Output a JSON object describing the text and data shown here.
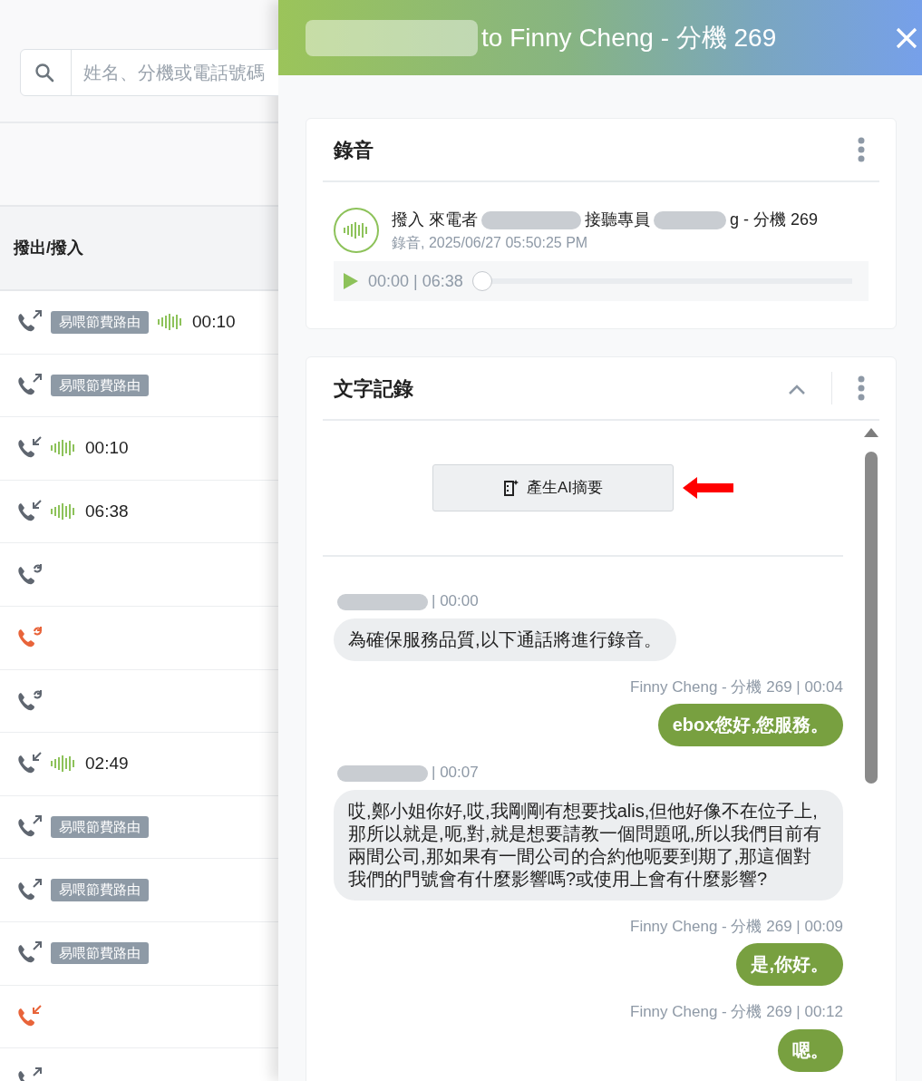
{
  "search": {
    "placeholder": "姓名、分機或電話號碼"
  },
  "table": {
    "columns": [
      "撥出/撥入"
    ],
    "rows": [
      {
        "kind": "outgoing",
        "missed": false,
        "tag": "易喂節費路由",
        "recording": "00:10"
      },
      {
        "kind": "outgoing",
        "missed": false,
        "tag": "易喂節費路由"
      },
      {
        "kind": "incoming",
        "missed": false,
        "recording": "00:10"
      },
      {
        "kind": "incoming",
        "missed": false,
        "recording": "06:38"
      },
      {
        "kind": "transfer",
        "missed": false
      },
      {
        "kind": "transfer",
        "missed": true
      },
      {
        "kind": "transfer",
        "missed": false
      },
      {
        "kind": "incoming",
        "missed": false,
        "recording": "02:49"
      },
      {
        "kind": "outgoing",
        "missed": false,
        "tag": "易喂節費路由"
      },
      {
        "kind": "outgoing",
        "missed": false,
        "tag": "易喂節費路由"
      },
      {
        "kind": "outgoing",
        "missed": false,
        "tag": "易喂節費路由"
      },
      {
        "kind": "incoming",
        "missed": true
      },
      {
        "kind": "outgoing",
        "missed": false
      }
    ]
  },
  "drawer": {
    "title": "to Finny Cheng - 分機 269"
  },
  "recording": {
    "title": "錄音",
    "direction": "撥入",
    "caller_label": "來電者",
    "agent_label": "接聽專員",
    "agent_suffix": "g - 分機 269",
    "subtitle": "錄音, 2025/06/27 05:50:25 PM",
    "time": "00:00 | 06:38",
    "level": 0
  },
  "transcript": {
    "title": "文字記錄",
    "expanded": true,
    "button": "產生AI摘要",
    "messages": [
      {
        "kind": "caller",
        "speaker": "| 00:00",
        "text": "為確保服務品質,以下通話將進行錄音。"
      },
      {
        "kind": "agent",
        "speaker": "Finny Cheng - 分機 269 | 00:04",
        "text": "ebox您好,您服務。"
      },
      {
        "kind": "caller",
        "speaker": "| 00:07",
        "text": "哎,鄭小姐你好,哎,我剛剛有想要找alis,但他好像不在位子上,那所以就是,呃,對,就是想要請教一個問題吼,所以我們目前有兩間公司,那如果有一間公司的合約他呃要到期了,那這個對我們的門號會有什麼影響嗎?或使用上會有什麼影響?"
      },
      {
        "kind": "agent",
        "speaker": "Finny Cheng - 分機 269 | 00:09",
        "text": "是,你好。"
      },
      {
        "kind": "agent",
        "speaker": "Finny Cheng - 分機 269 | 00:12",
        "text": "嗯。"
      }
    ]
  }
}
